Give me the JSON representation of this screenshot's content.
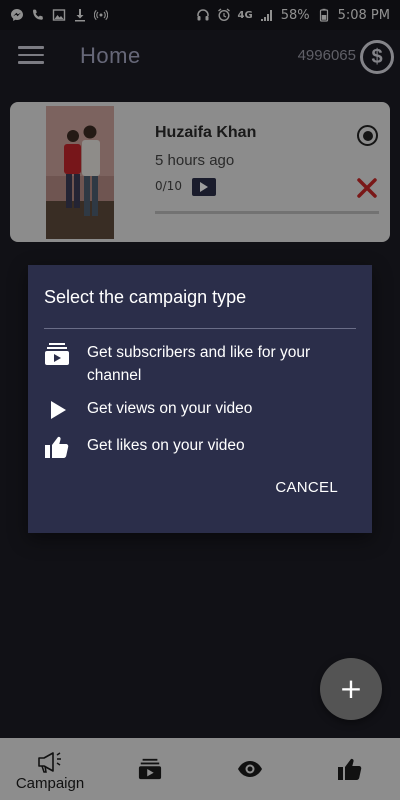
{
  "status_bar": {
    "battery": "58%",
    "time": "5:08 PM",
    "network": "4G"
  },
  "app_bar": {
    "title": "Home",
    "coins": "4996065",
    "coin_symbol": "$"
  },
  "campaign_card": {
    "name": "Huzaifa Khan",
    "time_ago": "5 hours ago",
    "progress_text": "0/10",
    "progress": 0
  },
  "dialog": {
    "title": "Select the campaign type",
    "options": [
      {
        "label": "Get subscribers and like for your channel",
        "icon": "subscriptions-icon"
      },
      {
        "label": "Get views on your video",
        "icon": "play-icon"
      },
      {
        "label": "Get likes on your video",
        "icon": "thumb-up-icon"
      }
    ],
    "cancel_label": "CANCEL"
  },
  "fab": {
    "label": "+"
  },
  "bottom_nav": {
    "items": [
      {
        "label": "Campaign",
        "icon": "megaphone-icon"
      },
      {
        "label": "",
        "icon": "subscriptions-icon"
      },
      {
        "label": "",
        "icon": "eye-icon"
      },
      {
        "label": "",
        "icon": "thumb-up-icon"
      }
    ]
  },
  "colors": {
    "background": "#1c1c24",
    "dialog": "#2b2e4a",
    "accent_dark": "#2a2e47",
    "close_red": "#c62828",
    "bottom_nav": "#8d8d8d"
  }
}
